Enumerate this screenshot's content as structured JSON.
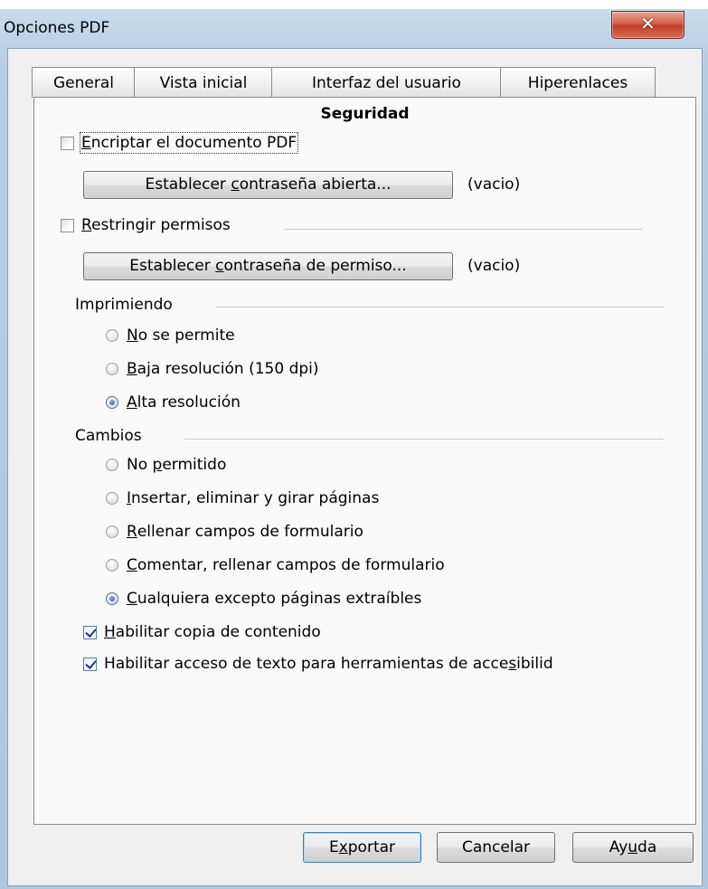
{
  "window": {
    "title": "Opciones PDF",
    "close_glyph": "✕"
  },
  "tabs": [
    "General",
    "Vista inicial",
    "Interfaz del usuario",
    "Hiperenlaces"
  ],
  "active_tab": "Seguridad",
  "encrypt": {
    "checkbox_label_pre": "",
    "checkbox_label_acc": "E",
    "checkbox_label_post": "ncriptar el documento PDF",
    "checked": false,
    "button_pre": "Establecer ",
    "button_acc": "c",
    "button_post": "ontraseña abierta...",
    "status": "(vacio)"
  },
  "restrict": {
    "checkbox_label_acc": "R",
    "checkbox_label_post": "estringir permisos",
    "checked": false,
    "button_pre": "Establecer ",
    "button_acc": "c",
    "button_post": "ontraseña de permiso...",
    "status": "(vacio)"
  },
  "printing": {
    "title": "Imprimiendo",
    "options": [
      {
        "acc": "N",
        "post": "o se permite",
        "pre": "",
        "selected": false
      },
      {
        "acc": "B",
        "post": "aja resolución (150 dpi)",
        "pre": "",
        "selected": false
      },
      {
        "acc": "A",
        "post": "lta resolución",
        "pre": "",
        "selected": true
      }
    ]
  },
  "changes": {
    "title": "Cambios",
    "options": [
      {
        "pre": "No ",
        "acc": "p",
        "post": "ermitido",
        "selected": false
      },
      {
        "pre": "",
        "acc": "I",
        "post": "nsertar, eliminar y girar páginas",
        "selected": false
      },
      {
        "pre": "",
        "acc": "R",
        "post": "ellenar campos de formulario",
        "selected": false
      },
      {
        "pre": "",
        "acc": "C",
        "post": "omentar, rellenar campos de formulario",
        "selected": false
      },
      {
        "pre": "",
        "acc": "C",
        "post": "ualquiera excepto páginas extraíbles",
        "selected": true
      }
    ]
  },
  "copy": {
    "pre": "",
    "acc": "H",
    "post": "abilitar copia de contenido",
    "checked": true
  },
  "access": {
    "pre": "Habilitar acceso de texto para herramientas de acce",
    "acc": "s",
    "post": "ibilid",
    "checked": true
  },
  "buttons": {
    "export": {
      "pre": "E",
      "acc": "x",
      "post": "portar"
    },
    "cancel": "Cancelar",
    "help": {
      "pre": "Ay",
      "acc": "u",
      "post": "da"
    }
  }
}
